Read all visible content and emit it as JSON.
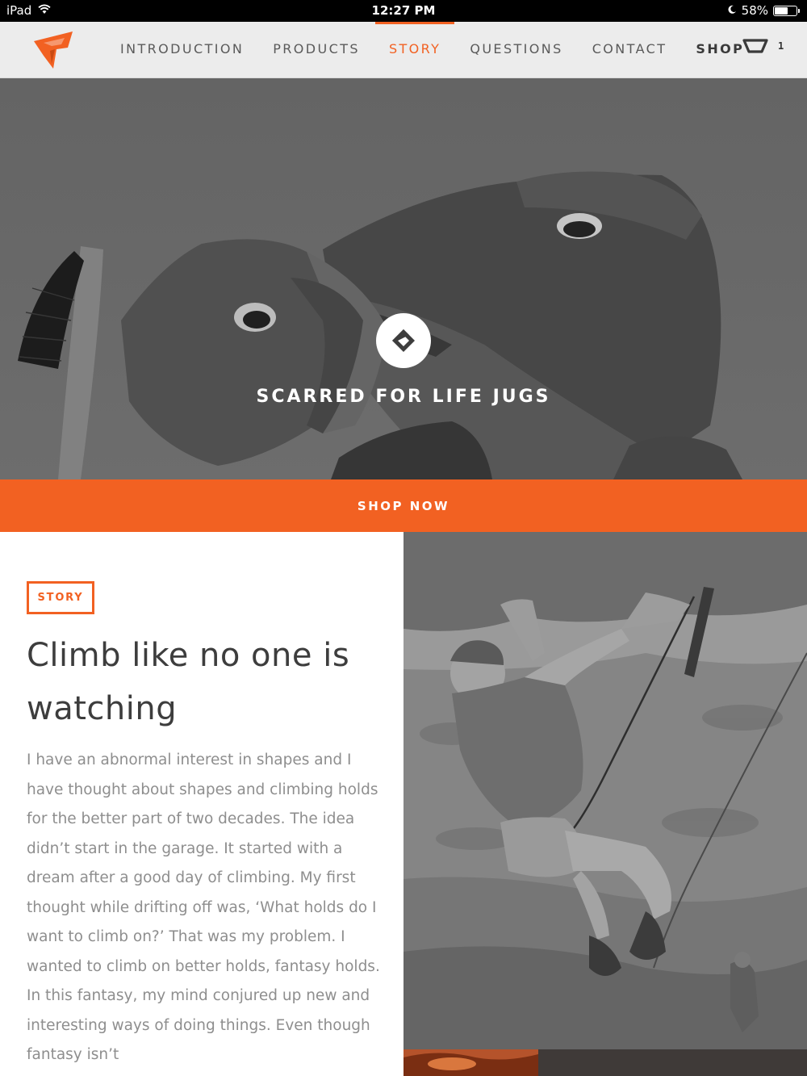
{
  "status_bar": {
    "device": "iPad",
    "time": "12:27 PM",
    "battery": "58%",
    "battery_level": 0.58
  },
  "nav": {
    "items": [
      {
        "label": "INTRODUCTION",
        "active": false
      },
      {
        "label": "PRODUCTS",
        "active": false
      },
      {
        "label": "STORY",
        "active": true
      },
      {
        "label": "QUESTIONS",
        "active": false
      },
      {
        "label": "CONTACT",
        "active": false
      },
      {
        "label": "SHOP",
        "active": false
      }
    ],
    "cart_count": "1",
    "icons": [
      "brand-logo-icon",
      "cart-icon"
    ]
  },
  "hero": {
    "title": "SCARRED FOR LIFE JUGS",
    "badge_icon": "diamond-hold-icon"
  },
  "shop_now": {
    "label": "SHOP NOW"
  },
  "story": {
    "tag": "STORY",
    "heading": "Climb like no one is watching",
    "body": "I have an abnormal interest in shapes and I have thought about shapes and climbing holds for the better part of two decades. The idea didn’t start in the garage. It started with a dream after a good day of climbing. My first thought while drifting off was, ‘What holds do I want to climb on?’ That was my problem. I wanted to climb on better holds, fantasy holds. In this fantasy, my mind conjured up new and interesting ways of doing things. Even though fantasy isn’t"
  },
  "colors": {
    "accent": "#f26122",
    "nav_bg": "#ececec",
    "heading_text": "#3d3d3d",
    "body_text": "#8e8e8e"
  }
}
